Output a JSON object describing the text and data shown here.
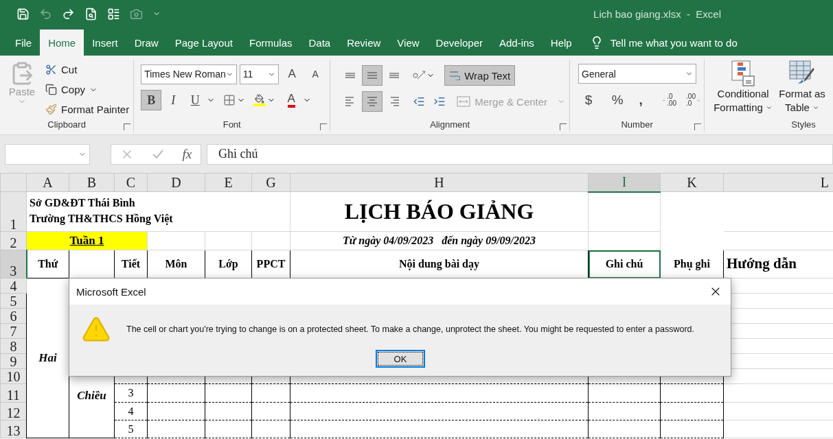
{
  "title_bar": {
    "title": "Lich bao giang.xlsx  -  Excel",
    "quick_access": [
      {
        "kind": "save",
        "disabled": false
      },
      {
        "kind": "undo",
        "disabled": true
      },
      {
        "kind": "redo",
        "disabled": false
      },
      {
        "kind": "preview",
        "disabled": false
      },
      {
        "kind": "form",
        "disabled": false
      },
      {
        "kind": "camera",
        "disabled": true
      }
    ]
  },
  "ribbon_tabs": [
    {
      "label": "File",
      "selected": false
    },
    {
      "label": "Home",
      "selected": true
    },
    {
      "label": "Insert",
      "selected": false
    },
    {
      "label": "Draw",
      "selected": false
    },
    {
      "label": "Page Layout",
      "selected": false
    },
    {
      "label": "Formulas",
      "selected": false
    },
    {
      "label": "Data",
      "selected": false
    },
    {
      "label": "Review",
      "selected": false
    },
    {
      "label": "View",
      "selected": false
    },
    {
      "label": "Developer",
      "selected": false
    },
    {
      "label": "Add-ins",
      "selected": false
    },
    {
      "label": "Help",
      "selected": false
    }
  ],
  "tell_me": "Tell me what you want to do",
  "clipboard": {
    "paste": "Paste",
    "cut": "Cut",
    "copy": "Copy",
    "format_painter": "Format Painter",
    "label": "Clipboard"
  },
  "font": {
    "name": "Times New Roman",
    "size": "11",
    "grow": "A",
    "shrink": "A",
    "styles": [
      {
        "kind": "bold",
        "label": "B",
        "selected": true
      },
      {
        "kind": "italic",
        "label": "I",
        "selected": false
      },
      {
        "kind": "underline",
        "label": "U",
        "selected": false
      }
    ],
    "font_color": "A",
    "label": "Font"
  },
  "alignment": {
    "vertical": [
      {
        "kind": "top",
        "selected": false
      },
      {
        "kind": "middle",
        "selected": true
      },
      {
        "kind": "bottom",
        "selected": false
      }
    ],
    "horizontal": [
      {
        "kind": "left",
        "selected": false
      },
      {
        "kind": "center",
        "selected": true
      },
      {
        "kind": "right",
        "selected": false
      }
    ],
    "wrap_text": {
      "label": "Wrap Text",
      "selected": true
    },
    "merge_center": {
      "label": "Merge & Center",
      "disabled": true
    },
    "label": "Alignment"
  },
  "number": {
    "format": "General",
    "currency": "$",
    "percent": "%",
    "comma": ",",
    "decimals": [
      {
        "top": ".0",
        "bottom": ".00"
      },
      {
        "top": ".00",
        "bottom": ".0"
      }
    ],
    "label": "Number"
  },
  "styles": {
    "buttons": [
      "Conditional Formatting",
      "Format as Table"
    ],
    "label": "Styles"
  },
  "formula_bar": {
    "fx": "fx",
    "value": "Ghi chú"
  },
  "column_headers": [
    {
      "label": "A",
      "selected": false
    },
    {
      "label": "B",
      "selected": false
    },
    {
      "label": "C",
      "selected": false
    },
    {
      "label": "D",
      "selected": false
    },
    {
      "label": "E",
      "selected": false
    },
    {
      "label": "G",
      "selected": false
    },
    {
      "label": "H",
      "selected": false
    },
    {
      "label": "I",
      "selected": true
    },
    {
      "label": "K",
      "selected": false
    },
    {
      "label": "L",
      "selected": false
    }
  ],
  "row_headers": [
    {
      "label": "1",
      "selected": false
    },
    {
      "label": "2",
      "selected": false
    },
    {
      "label": "3",
      "selected": true
    },
    {
      "label": "4",
      "selected": false
    },
    {
      "label": "5",
      "selected": false
    },
    {
      "label": "6",
      "selected": false
    },
    {
      "label": "7",
      "selected": false
    },
    {
      "label": "8",
      "selected": false
    },
    {
      "label": "9",
      "selected": false
    },
    {
      "label": "10",
      "selected": false
    },
    {
      "label": "11",
      "selected": false
    },
    {
      "label": "12",
      "selected": false
    },
    {
      "label": "13",
      "selected": false
    }
  ],
  "sheet": {
    "school_lines": [
      "Sở GD&ĐT Thái Bình",
      "Trường TH&THCS Hồng Việt"
    ],
    "title": "LỊCH BÁO GIẢNG",
    "week": "Tuần 1",
    "date_range": "Từ ngày 04/09/2023   đến ngày 09/09/2023",
    "header_row": [
      {
        "text": "Thứ",
        "selected": false
      },
      {
        "text": "Tiết",
        "selected": false
      },
      {
        "text": "Môn",
        "selected": false
      },
      {
        "text": "Lớp",
        "selected": false
      },
      {
        "text": "PPCT",
        "selected": false
      },
      {
        "text": "Nội dung bài dạy",
        "selected": false
      },
      {
        "text": "Ghi chú",
        "selected": true
      },
      {
        "text": "Phụ ghi",
        "selected": false
      },
      {
        "text": "Hướng dẫn",
        "selected": false
      }
    ],
    "day": "Hai",
    "session": "Chiều",
    "periods": [
      "3",
      "4",
      "5"
    ]
  },
  "dialog": {
    "title": "Microsoft Excel",
    "message": "The cell or chart you're trying to change is on a protected sheet. To make a change, unprotect the sheet. You might be requested to enter a password.",
    "button": "OK"
  }
}
